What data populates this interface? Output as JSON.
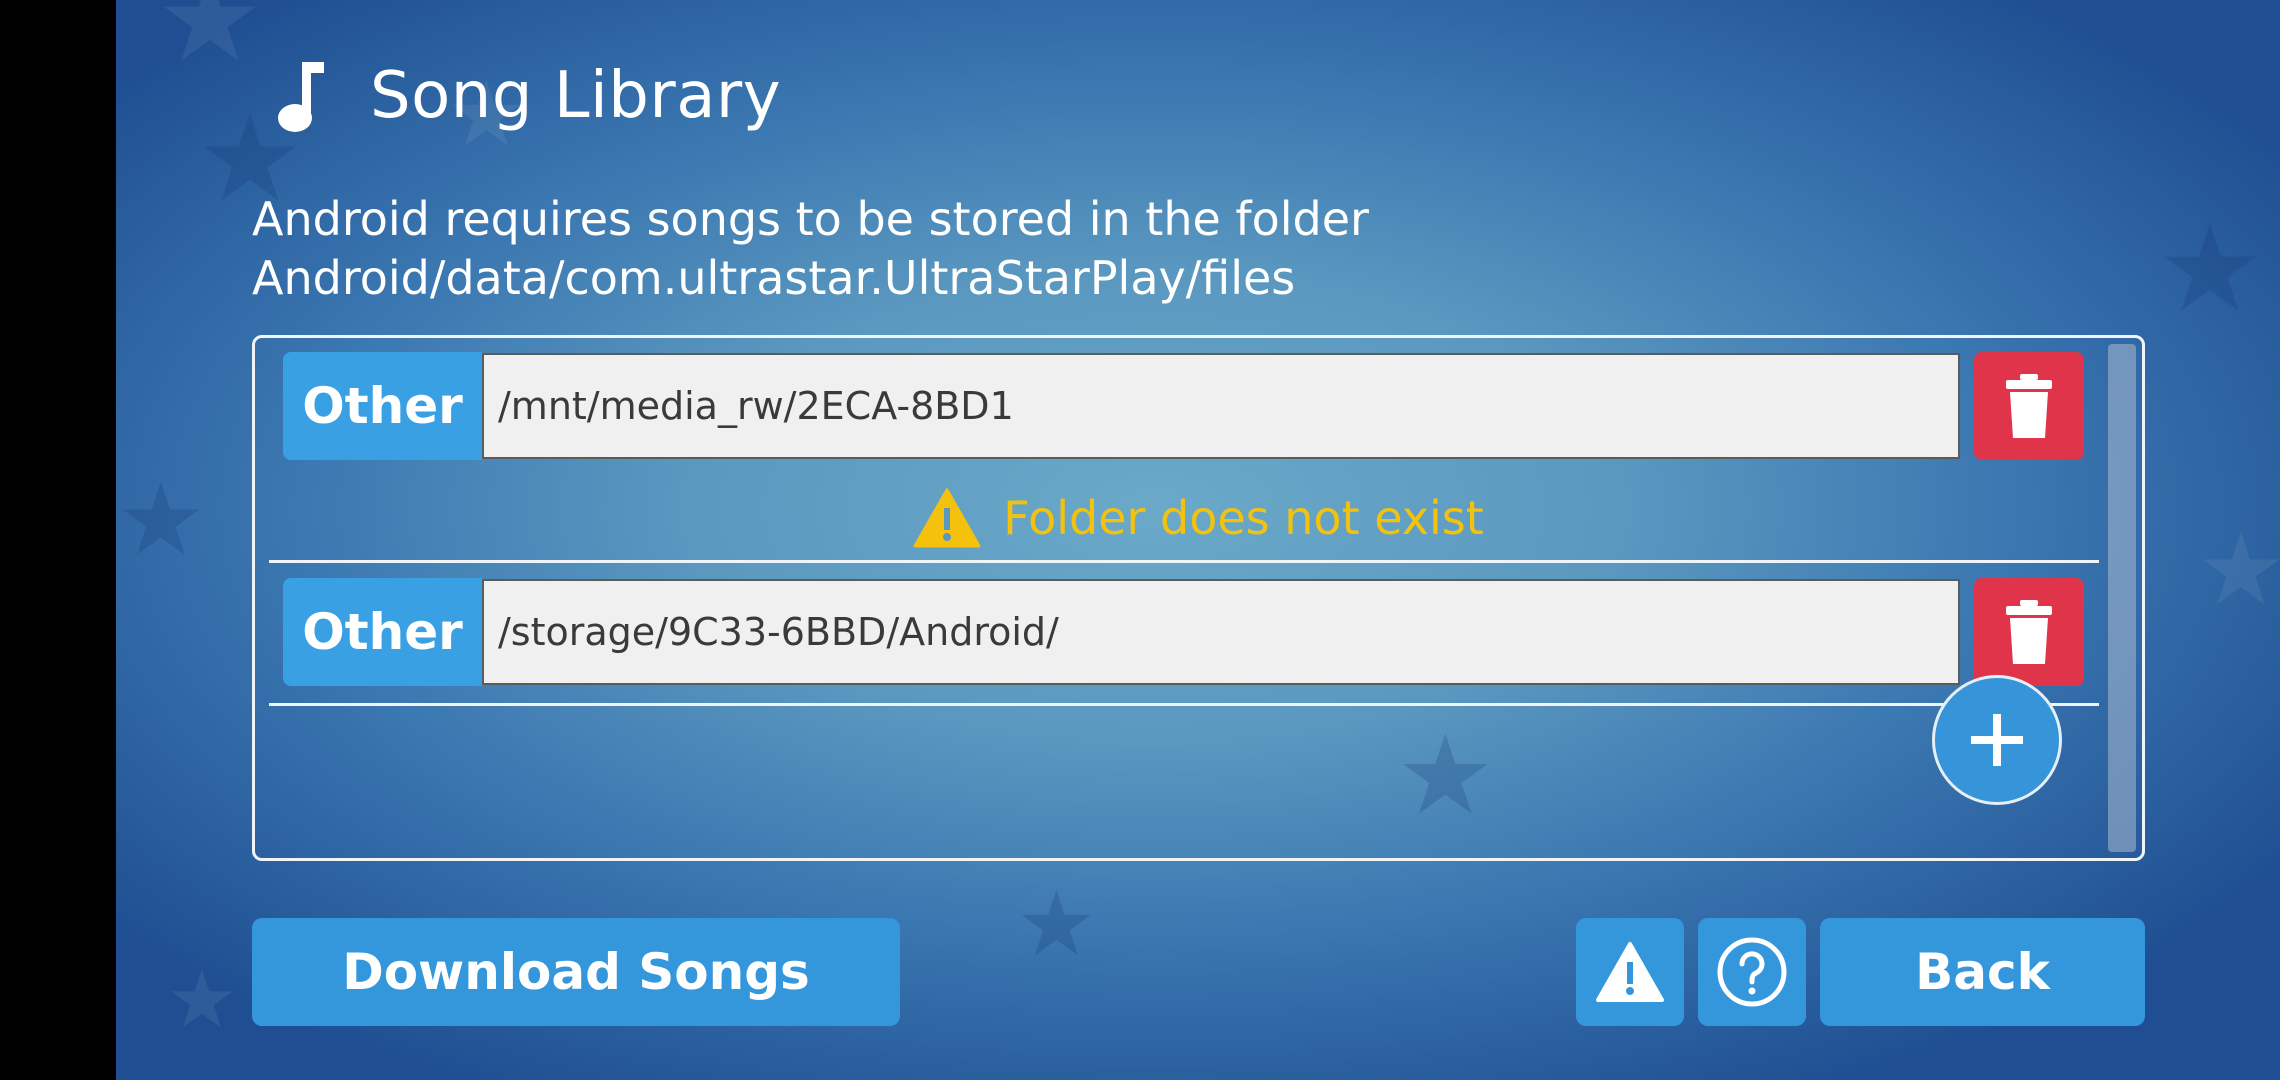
{
  "header": {
    "title": "Song Library",
    "icon": "music-note-icon"
  },
  "notice": {
    "line1": "Android requires songs to be stored in the folder",
    "line2": "Android/data/com.ultrastar.UltraStarPlay/files"
  },
  "folders": [
    {
      "type_label": "Other",
      "path": "/mnt/media_rw/2ECA-8BD1",
      "warning": "Folder does not exist"
    },
    {
      "type_label": "Other",
      "path": "/storage/9C33-6BBD/Android/"
    }
  ],
  "buttons": {
    "download": "Download Songs",
    "back": "Back",
    "add_icon": "plus-icon",
    "warning_icon": "warning-icon",
    "help_icon": "help-icon",
    "delete_icon": "trash-icon"
  },
  "colors": {
    "accent": "#3497dc",
    "delete": "#e0344a",
    "warning": "#f4c20d"
  }
}
